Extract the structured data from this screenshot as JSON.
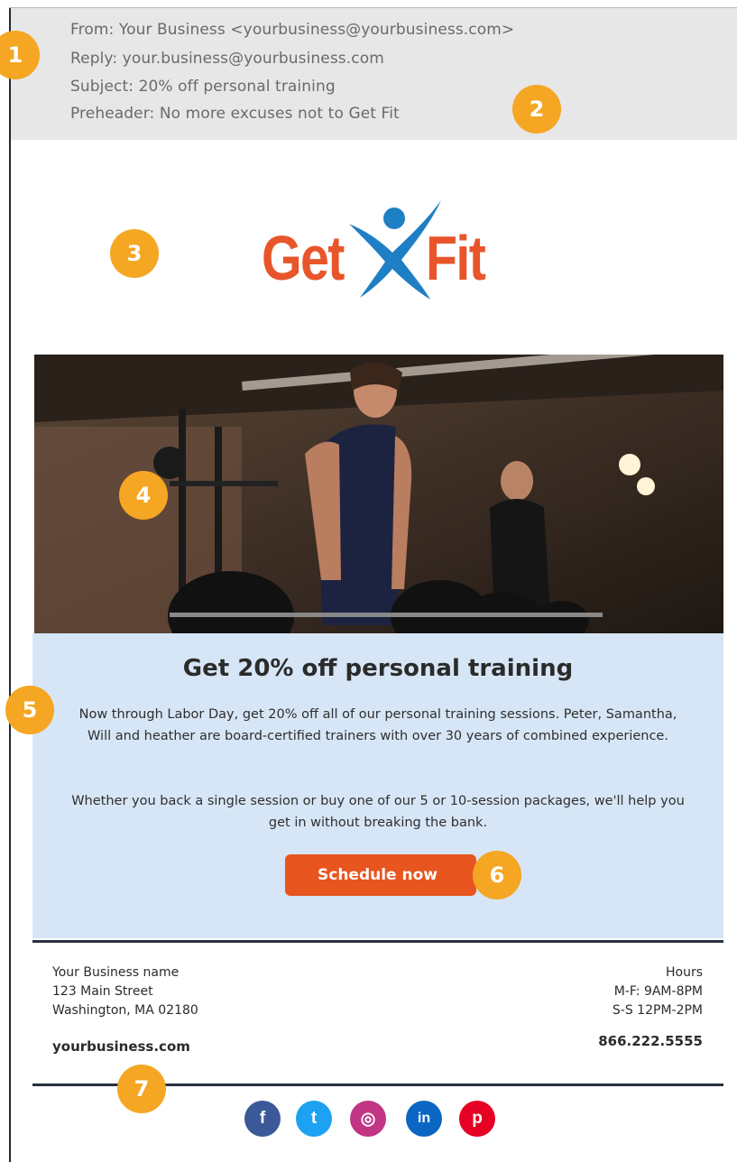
{
  "email_header": {
    "from": "From: Your Business <yourbusiness@yourbusiness.com>",
    "reply": "Reply: your.business@yourbusiness.com",
    "subject": "Subject: 20% off personal training",
    "preheader": "Preheader: No more excuses not to Get Fit"
  },
  "badges": [
    "1",
    "2",
    "3",
    "4",
    "5",
    "6",
    "7"
  ],
  "logo": {
    "left_word": "Get",
    "right_word": "Fit",
    "icon": "figure-icon"
  },
  "hero": {
    "icon": "gym-photo"
  },
  "promo": {
    "title": "Get 20% off personal training",
    "paragraph1": "Now through Labor Day, get 20% off all of our personal training sessions. Peter, Samantha, Will and heather are board-certified trainers with over 30 years of combined experience.",
    "paragraph2": "Whether you back a single session or buy one of our 5 or 10-session packages, we'll help you get in without breaking the bank.",
    "cta_label": "Schedule now"
  },
  "footer": {
    "business_name": "Your Business name",
    "street": "123 Main Street",
    "city": "Washington, MA 02180",
    "website": "yourbusiness.com",
    "hours_label": "Hours",
    "hours_weekday": "M-F: 9AM-8PM",
    "hours_weekend": "S-S 12PM-2PM",
    "phone": "866.222.5555"
  },
  "social": [
    {
      "name": "facebook",
      "glyph": "f",
      "color": "#3b5998"
    },
    {
      "name": "twitter",
      "glyph": "t",
      "color": "#1da1f2"
    },
    {
      "name": "instagram",
      "glyph": "◎",
      "color": "#c13584"
    },
    {
      "name": "linkedin",
      "glyph": "in",
      "color": "#0a66c2"
    },
    {
      "name": "pinterest",
      "glyph": "p",
      "color": "#e60023"
    }
  ],
  "colors": {
    "accent": "#e8551f",
    "badge": "#f5a623",
    "panel": "#d7e6f6",
    "logo_blue": "#1f7fc4"
  }
}
